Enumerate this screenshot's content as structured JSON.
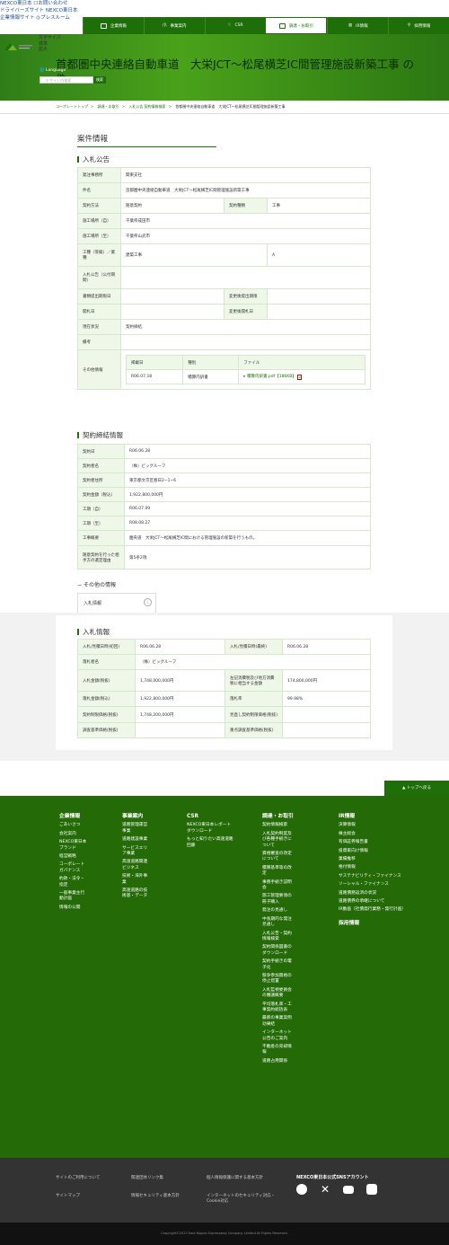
{
  "top_links": [
    "NEXCO東日本",
    "お問い合わせ",
    "ドライバーズサイト",
    "NEXCO東日本",
    "企業情報サイト",
    "プレスルーム"
  ],
  "nav": [
    "企業情報",
    "事業案内",
    "CSR",
    "調達・お取引",
    "IR情報",
    "採用情報"
  ],
  "size_labels": [
    "文字サイズ",
    "標準",
    "拡大"
  ],
  "language": "Language",
  "search": {
    "placeholder": "サイト内検索",
    "button": "検索"
  },
  "hero_title": "首都圏中央連絡自動車道　大栄JCT〜松尾横芝IC間管理施設新築工事 の",
  "hero_title2": "件情報",
  "breadcrumb": [
    "コーポレートトップ",
    "調達・お取引",
    "入札公告 契約情報検索",
    "首都圏中央連絡自動車道　大栄JCT〜松尾横芝IC間管理施設新築工事"
  ],
  "section_title": "案件情報",
  "bid_notice": {
    "title": "入札公告",
    "rows": [
      {
        "k": "発注事務所",
        "v": "関東支社"
      },
      {
        "k": "件名",
        "v": "首都圏中央連絡自動車道　大栄JCT〜松尾横芝IC間管理施設新築工事"
      },
      {
        "k": "契約方法",
        "v": "随意契約",
        "k2": "契約種類",
        "v2": "工事"
      },
      {
        "k": "施工場所（自）",
        "v": "千葉県成田市"
      },
      {
        "k": "施工場所（至）",
        "v": "千葉県山武市"
      },
      {
        "k": "工種（等級）／業種",
        "v": "建築工事",
        "v2": "A"
      },
      {
        "k": "入札公告（公付期間）",
        "v": ""
      },
      {
        "k": "書類提出期限日",
        "v": "",
        "k2": "変更後提出期限",
        "v2": ""
      },
      {
        "k": "開札日",
        "v": "",
        "k2": "変更後開札日",
        "v2": ""
      },
      {
        "k": "現在状況",
        "v": "契約締結"
      },
      {
        "k": "備考",
        "v": ""
      }
    ],
    "other_label": "その他情報",
    "files_header": [
      "掲載日",
      "種別",
      "ファイル"
    ],
    "files": [
      {
        "date": "R06.07.18",
        "type": "積算内訳書",
        "file": "積算内訳書.pdf【186KB】"
      }
    ]
  },
  "contract": {
    "title": "契約締結情報",
    "rows": [
      {
        "k": "契約日",
        "v": "R06.06.28"
      },
      {
        "k": "契約者名",
        "v": "（株）ビッグルーフ"
      },
      {
        "k": "契約者住所",
        "v": "東京都文京区春日2−1−6"
      },
      {
        "k": "契約金額（税込）",
        "v": "1,922,800,000円"
      },
      {
        "k": "工期（自）",
        "v": "R06.07.09"
      },
      {
        "k": "工期（至）",
        "v": "R08.08.27"
      },
      {
        "k": "工事概要",
        "v": "圏央道　大栄JCT〜松尾横芝IC間における管理施設の新築を行うもの。"
      },
      {
        "k": "随意契約を行った相手方の選定理由",
        "v": "第5条2項"
      }
    ]
  },
  "other_info": {
    "label": "その他の情報",
    "tab": "入札情報",
    "title": "入札情報",
    "rows": [
      {
        "k": "入札/見積日時(初回)",
        "v": "R06.06.28",
        "k2": "入札/見積日時(最終)",
        "v2": "R06.06.28"
      },
      {
        "k": "落札者名",
        "v": "（株）ビッグルーフ"
      },
      {
        "k": "入札金額(税抜)",
        "v": "1,748,000,000円",
        "k2": "左記消費税及び地方消費税に相当する金額",
        "v2": "174,800,000円"
      },
      {
        "k": "落札金額(税込)",
        "v": "1,922,800,000円",
        "k2": "落札率",
        "v2": "99.98%"
      },
      {
        "k": "契約制限価格(税抜)",
        "v": "1,748,200,000円",
        "k2": "見直し契約制限価格(税抜)",
        "v2": ""
      },
      {
        "k": "調査基準価格(税抜)",
        "v": "",
        "k2": "重点調査基準価格(税抜)",
        "v2": ""
      }
    ]
  },
  "to_top": "トップへ戻る",
  "footer_cols": [
    {
      "head": "企業情報",
      "items": [
        "ごあいさつ",
        "会社案内",
        "NEXCO東日本ブランド",
        "経営戦略",
        "コーポレートガバナンス",
        "約款・法令・指定",
        "一般事業主行動計画",
        "情報の公開"
      ]
    },
    {
      "head": "事業案内",
      "items": [
        "道路管理運営事業",
        "道路建設事業",
        "サービスエリア事業",
        "高速道路関連ビジネス",
        "技術・海外事業",
        "高速道路の技術基・データ"
      ]
    },
    {
      "head": "CSR",
      "items": [
        "NEXCO東日本レポートダウンロード",
        "もっと知りたい高速道路回廊"
      ]
    },
    {
      "head": "調達・お取引",
      "items": [
        "契約情報検索",
        "入札契約制度及び各種手続きについて",
        "資格審査の改定について",
        "積算基準等の改定",
        "事務手続き説明会",
        "施工管理要領の冊子購入",
        "発注の見通し",
        "中長期的な発注見通し",
        "入札公告・契約情報検索",
        "契約関係図書のダウンロード",
        "契約手続きの電子化",
        "競争参加資格の停止措置",
        "入札監視委員会の審議概要",
        "平均落札率・工事契約総括表",
        "最新の事業案例効果結",
        "インターネット公告のご案内",
        "不動産の売却情報",
        "道路占用関係"
      ]
    },
    {
      "head": "IR情報",
      "items": [
        "決算情報",
        "株主総会",
        "有価証券報告書",
        "投資家向け情報",
        "業績推移",
        "格付情報",
        "サステナビリティ・ファイナンス",
        "ソーシャル・ファイナンス",
        "道路債務返済の状況",
        "道路債券の承継について",
        "IR動画（社債発行業務・発行計画）"
      ]
    },
    {
      "head": "採用情報",
      "items": []
    }
  ],
  "footer_links": [
    "サイトのご利用について",
    "関連団体リンク集",
    "個人情報保護に関する基本方針",
    "サイトマップ",
    "情報セキュリティ基本方針",
    "インターネットのセキュリティ対応・Cookie対応"
  ],
  "sns_title": "NEXCO東日本公式SNSアカウント",
  "sns_icons": [
    "facebook-icon",
    "x-icon",
    "youtube-icon",
    "instagram-icon"
  ],
  "copyright": "Copyright©2023 East Nippon Expressway Company Limited All Rights Reserved."
}
